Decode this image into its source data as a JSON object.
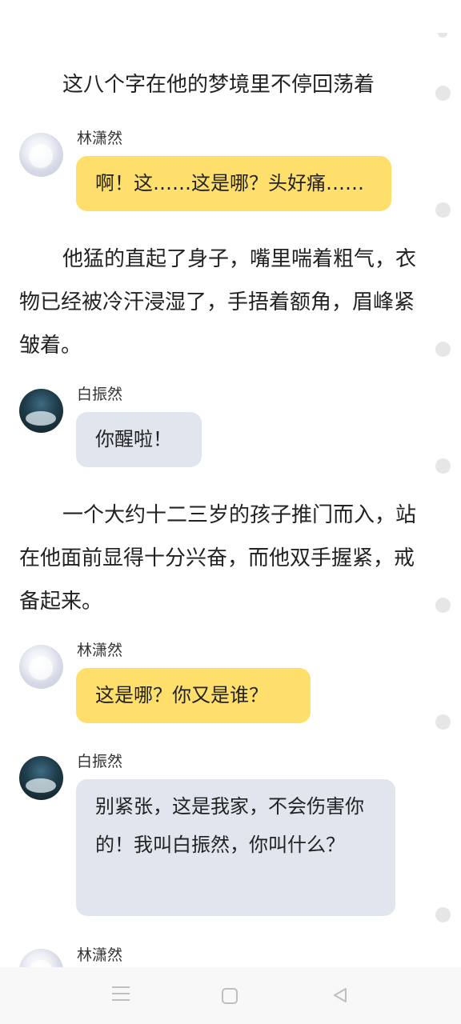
{
  "chat": {
    "messages": [
      {
        "type": "narration",
        "text": "这八个字在他的梦境里不停回荡着"
      },
      {
        "type": "dialog",
        "speaker": "林潇然",
        "text": "啊！这……这是哪？头好痛……",
        "color": "#fedf6b"
      },
      {
        "type": "narration",
        "text": "他猛的直起了身子，嘴里喘着粗气，衣物已经被冷汗浸湿了，手捂着额角，眉峰紧皱着。"
      },
      {
        "type": "dialog",
        "speaker": "白振然",
        "text": "你醒啦！",
        "color": "#e1e6ee"
      },
      {
        "type": "narration",
        "text": "一个大约十二三岁的孩子推门而入，站在他面前显得十分兴奋，而他双手握紧，戒备起来。"
      },
      {
        "type": "dialog",
        "speaker": "林潇然",
        "text": "这是哪？你又是谁？",
        "color": "#fedf6b"
      },
      {
        "type": "dialog",
        "speaker": "白振然",
        "text": "别紧张，这是我家，不会伤害你的！我叫白振然，你叫什么？",
        "color": "#e1e6ee"
      },
      {
        "type": "dialog",
        "speaker": "林潇然",
        "text": ""
      }
    ]
  },
  "navbar": {
    "icons": [
      "menu-icon",
      "home-icon",
      "back-icon"
    ]
  }
}
